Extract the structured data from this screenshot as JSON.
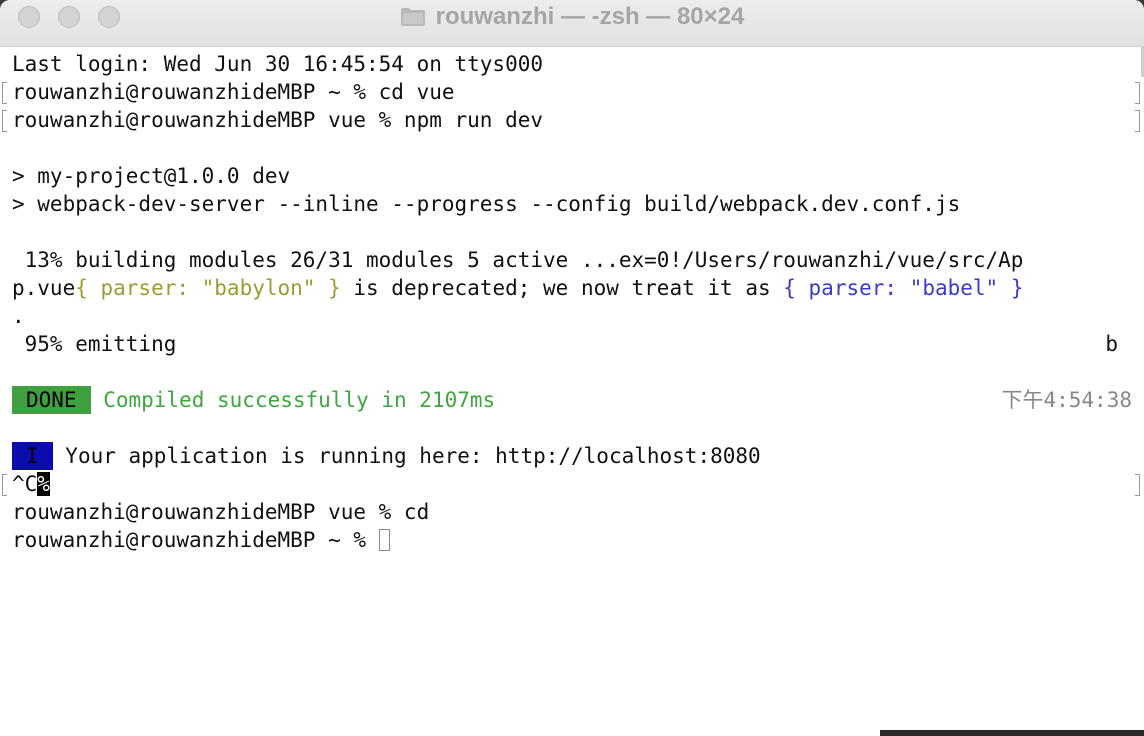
{
  "window": {
    "title": "rouwanzhi — -zsh — 80×24"
  },
  "terminal": {
    "lines": {
      "l1": "Last login: Wed Jun 30 16:45:54 on ttys000",
      "l2": "rouwanzhi@rouwanzhideMBP ~ % cd vue",
      "l3": "rouwanzhi@rouwanzhideMBP vue % npm run dev",
      "l5": "> my-project@1.0.0 dev",
      "l6": "> webpack-dev-server --inline --progress --config build/webpack.dev.conf.js",
      "l8": " 13% building modules 26/31 modules 5 active ...ex=0!/Users/rouwanzhi/vue/src/Ap",
      "l9_a": "p.vue",
      "l9_b": "{ parser: \"babylon\" }",
      "l9_c": " is deprecated; we now treat it as ",
      "l9_d": "{ parser: \"babel\" }",
      "l10": ".",
      "l11": " 95% emitting",
      "l11_right": "b",
      "l13_badge": "DONE",
      "l13_msg": " Compiled successfully in 2107ms",
      "l13_time": "下午4:54:38",
      "l15_badge": "I",
      "l15_msg": " Your application is running here: http://localhost:8080",
      "l16_a": "^C",
      "l16_b": "%",
      "l17": "rouwanzhi@rouwanzhideMBP vue % cd",
      "l18": "rouwanzhi@rouwanzhideMBP ~ % "
    }
  },
  "colors": {
    "done_bg": "#3fa03f",
    "info_bg": "#0b0bb0",
    "success_text": "#3da83d",
    "deprecated_babylon": "#9d9b32",
    "deprecated_babel": "#3b3bc7"
  }
}
